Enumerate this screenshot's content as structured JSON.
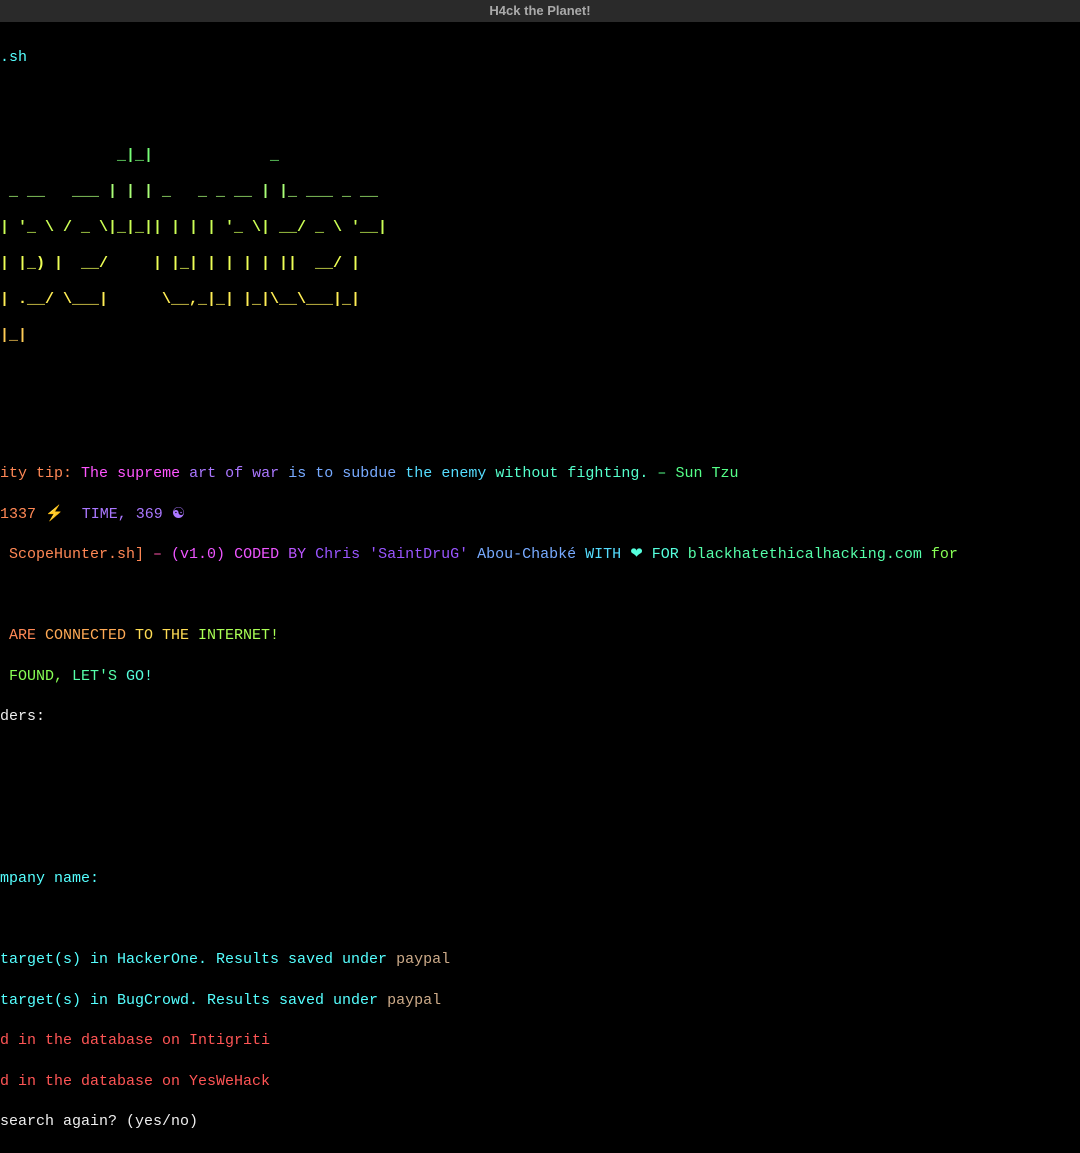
{
  "window": {
    "title": "H4ck the Planet!"
  },
  "terminal": {
    "command_suffix": ".sh",
    "ascii_art": [
      "             _ _             _            ",
      " _ __   ___ | | | _   _ _ __ | |_ ___ _ __ ",
      "| '_ \\\\ / _ \\\\| | || | | | '_ \\| __/ _ \\ '__|",
      "| |_) |  __/|_|_|| |_| | | | | ||  __/ |   ",
      "| .__/ \\___|     \\__,_|_| |_|\\__\\___|_|   ",
      "|_|                                        ",
      "                                           "
    ],
    "sec_tip": {
      "prefix": "ity tip:",
      "w1": "The",
      "w2": "supreme",
      "w3": "art",
      "w4": "of",
      "w5": "war",
      "w6": "is",
      "w7": "to",
      "w8": "subdue",
      "w9": "the",
      "w10": "enemy",
      "w11": "without",
      "w12": "fighting.",
      "w13": "–",
      "w14": "Sun",
      "w15": "Tzu"
    },
    "time_line": {
      "num": "1337",
      "bolt": "⚡",
      "t": "TIME,",
      "n2": "369",
      "emoji": "☯"
    },
    "credits": {
      "p1": " ScopeHunter.sh]",
      "p2": " –",
      "p3": " (v1.0)",
      "p4": " CODED",
      "p5": " BY",
      "p6": " Chris",
      "p7": " 'SaintDruG'",
      "p8": " Abou-Chabké",
      "p9": " WITH",
      "p10": " ❤",
      "p11": " FOR",
      "p12": " blackhatethicalhacking.com",
      "p13": " for"
    },
    "connected": {
      "p1": " ARE",
      "p2": " CONNECTED",
      "p3": " TO THE",
      "p4": " INTERNET!"
    },
    "found": {
      "p1": " FOUND,",
      "p2": " LET'S",
      "p3": " GO!"
    },
    "ders": "ders:",
    "prompt_company": "mpany name:",
    "hackerone": {
      "text": "target(s) in HackerOne. Results saved under ",
      "val": "paypal"
    },
    "bugcrowd": {
      "text": "target(s) in BugCrowd. Results saved under ",
      "val": "paypal"
    },
    "intigriti": "d in the database on Intigriti",
    "yeswehack": "d in the database on YesWeHack",
    "search_again": "search again? (yes/no)"
  }
}
